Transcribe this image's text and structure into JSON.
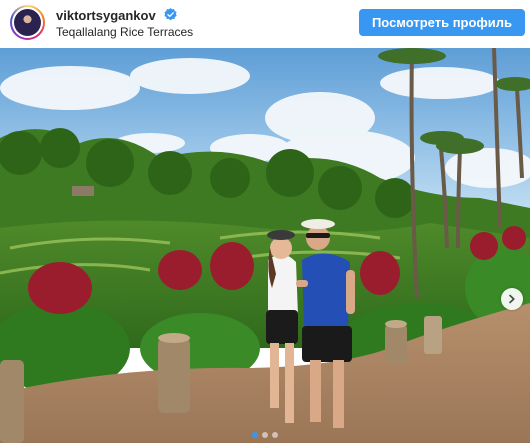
{
  "header": {
    "username": "viktortsygankov",
    "location": "Teqallalang Rice Terraces",
    "view_profile_label": "Посмотреть профиль",
    "verified_icon": "verified-badge-icon"
  },
  "carousel": {
    "dot_count": 3,
    "active_index": 0
  },
  "colors": {
    "accent": "#3897f0",
    "text": "#262626"
  }
}
